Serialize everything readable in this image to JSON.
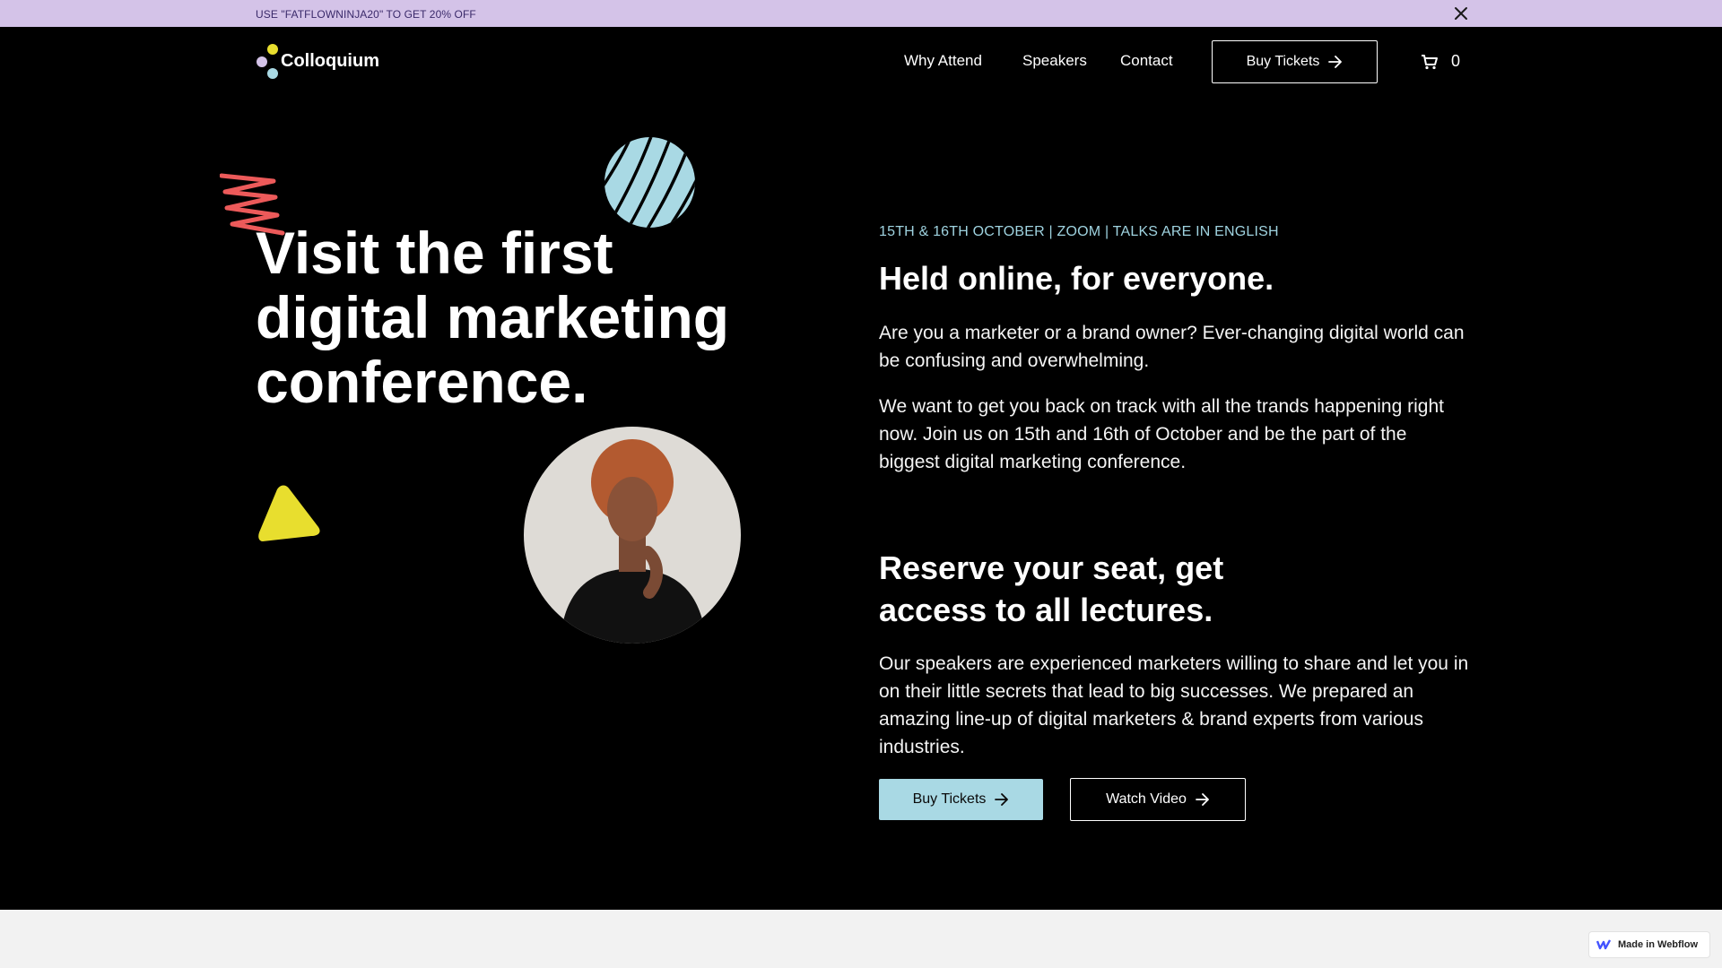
{
  "promo": {
    "text": "USE \"FATFLOWNINJA20\" TO GET 20% OFF",
    "close_icon": "close-icon"
  },
  "nav": {
    "logo_text": "Colloquium",
    "links": [
      "Why Attend",
      "Speakers",
      "Contact"
    ],
    "buy_label": "Buy Tickets",
    "cart_count": "0"
  },
  "hero": {
    "title_line1": "Visit the first",
    "title_line2": "digital marketing",
    "title_line3": "conference."
  },
  "info": {
    "eyebrow": "15TH & 16TH OCTOBER | ZOOM | TALKS ARE IN ENGLISH",
    "heading1": "Held online, for everyone.",
    "para1": "Are you a marketer or a brand owner? Ever-changing digital world can be confusing and overwhelming.",
    "para2": "We want to get you back on track with all the trands happening right now. Join us on  15th and 16th of October and be the part of the biggest digital marketing conference.",
    "heading2": "Reserve your seat, get access to all lectures.",
    "para3": "Our speakers are experienced marketers willing to share and let you in on their little secrets that lead to big successes. We prepared an amazing line-up of digital marketers & brand experts from various industries.",
    "buy_label": "Buy Tickets",
    "watch_label": "Watch Video"
  },
  "badge": {
    "text": "Made in Webflow"
  },
  "colors": {
    "promo_bg": "#d4c3e8",
    "accent_blue": "#a9d9e4",
    "accent_red": "#ec5a5a",
    "accent_yellow": "#e8de2e",
    "background": "#000000"
  }
}
